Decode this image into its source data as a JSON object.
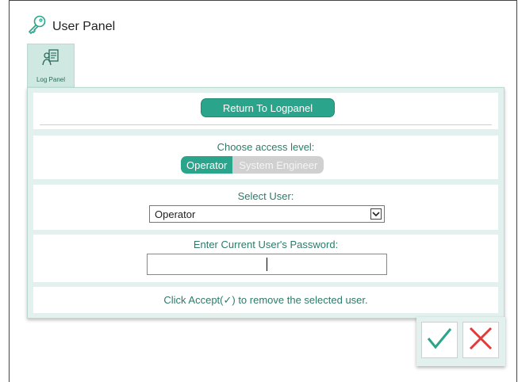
{
  "header": {
    "title": "User Panel",
    "icon": "key-icon"
  },
  "tab": {
    "label": "Log Panel",
    "icon": "user-log-icon"
  },
  "panel": {
    "return_button": "Return To Logpanel",
    "access_level": {
      "label": "Choose access level:",
      "options": [
        "Operator",
        "System Engineer"
      ],
      "selected": "Operator"
    },
    "select_user": {
      "label": "Select User:",
      "value": "Operator"
    },
    "password": {
      "label": "Enter Current User's Password:",
      "value": ""
    },
    "info_text": "Click Accept(✓) to remove the selected user."
  },
  "actions": {
    "accept_icon": "check-icon",
    "cancel_icon": "close-icon"
  },
  "colors": {
    "accent": "#2aa58b",
    "panel_bg": "#e3f1ee",
    "text_teal": "#2c7b69",
    "cancel_red": "#e03a3a",
    "accept_green": "#2aa58b"
  }
}
